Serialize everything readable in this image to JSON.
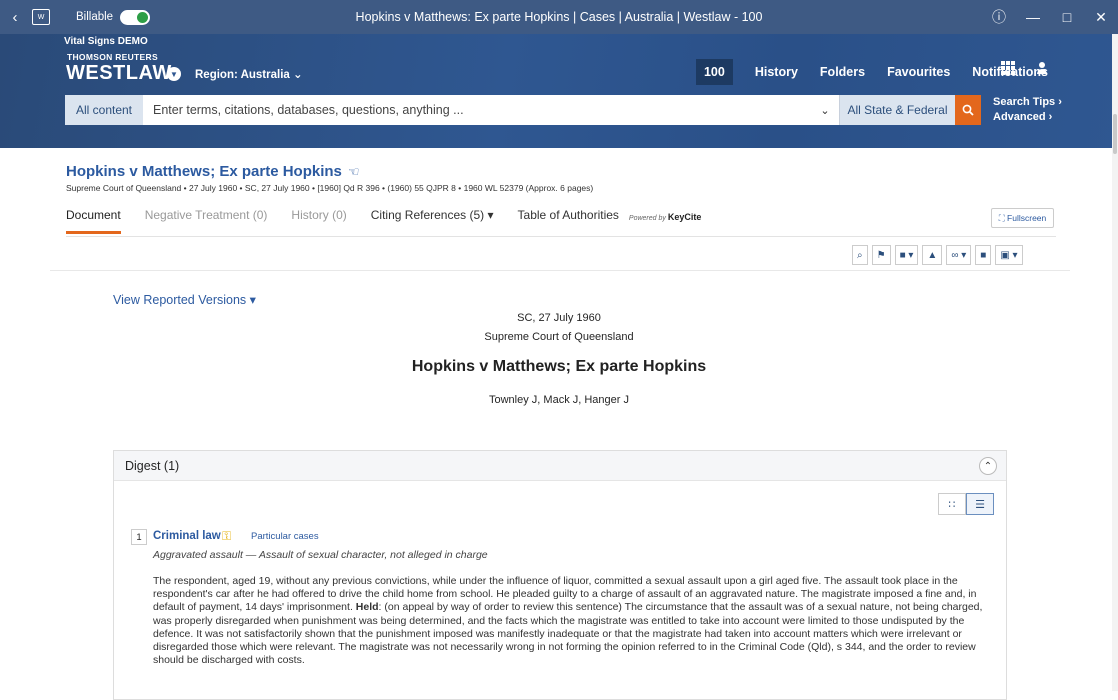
{
  "window": {
    "billable_label": "Billable",
    "title": "Hopkins v Matthews: Ex parte Hopkins | Cases | Australia | Westlaw - 100"
  },
  "header": {
    "demo_label": "Vital Signs DEMO",
    "brand_top": "THOMSON REUTERS",
    "brand_main": "WESTLAW",
    "region": "Region: Australia",
    "nav": {
      "count": "100",
      "history": "History",
      "folders": "Folders",
      "favourites": "Favourites",
      "notifications": "Notifications"
    },
    "search": {
      "scope": "All content",
      "placeholder": "Enter terms, citations, databases, questions, anything ...",
      "jurisdiction": "All State & Federal",
      "tips": "Search Tips ›",
      "advanced": "Advanced ›"
    }
  },
  "document": {
    "title": "Hopkins v Matthews; Ex parte Hopkins",
    "meta": "Supreme Court of Queensland • 27 July 1960 • SC, 27 July 1960 • [1960] Qd R 396 • (1960) 55 QJPR 8 • 1960 WL 52379 (Approx. 6 pages)",
    "tabs": {
      "document": "Document",
      "negative": "Negative Treatment (0)",
      "history": "History (0)",
      "citing": "Citing References (5)",
      "authorities": "Table of Authorities",
      "powered": "Powered by",
      "keycite": "KeyCite"
    },
    "fullscreen": "Fullscreen",
    "view_reported": "View Reported Versions",
    "court_date": "SC, 27 July 1960",
    "court": "Supreme Court of Queensland",
    "case_title": "Hopkins v Matthews; Ex parte Hopkins",
    "judges": "Townley J, Mack J, Hanger J"
  },
  "digest": {
    "heading": "Digest (1)",
    "entry": {
      "number": "1",
      "title": "Criminal law",
      "sub": "Particular cases",
      "italic": "Aggravated assault — Assault of sexual character, not alleged in charge",
      "body_pre": "The respondent, aged 19, without any previous convictions, while under the influence of liquor, committed a sexual assault upon a girl aged five. The assault took place in the respondent's car after he had offered to drive the child home from school. He pleaded guilty to a charge of assault of an aggravated nature. The magistrate imposed a fine and, in default of payment, 14 days' imprisonment. ",
      "held": "Held",
      "body_post": ": (on appeal by way of order to review this sentence) The circumstance that the assault was of a sexual nature, not being charged, was properly disregarded when punishment was being determined, and the facts which the magistrate was entitled to take into account were limited to those undisputed by the defence. It was not satisfactorily shown that the punishment imposed was manifestly inadequate or that the magistrate had taken into account matters which were irrelevant or disregarded those which were relevant. The magistrate was not necessarily wrong in not forming the opinion referred to in the Criminal Code (Qld), s 344, and the order to review should be discharged with costs."
    }
  },
  "colors": {
    "header": "#2f5791",
    "accent": "#e3671c",
    "link": "#2c5aa0"
  }
}
